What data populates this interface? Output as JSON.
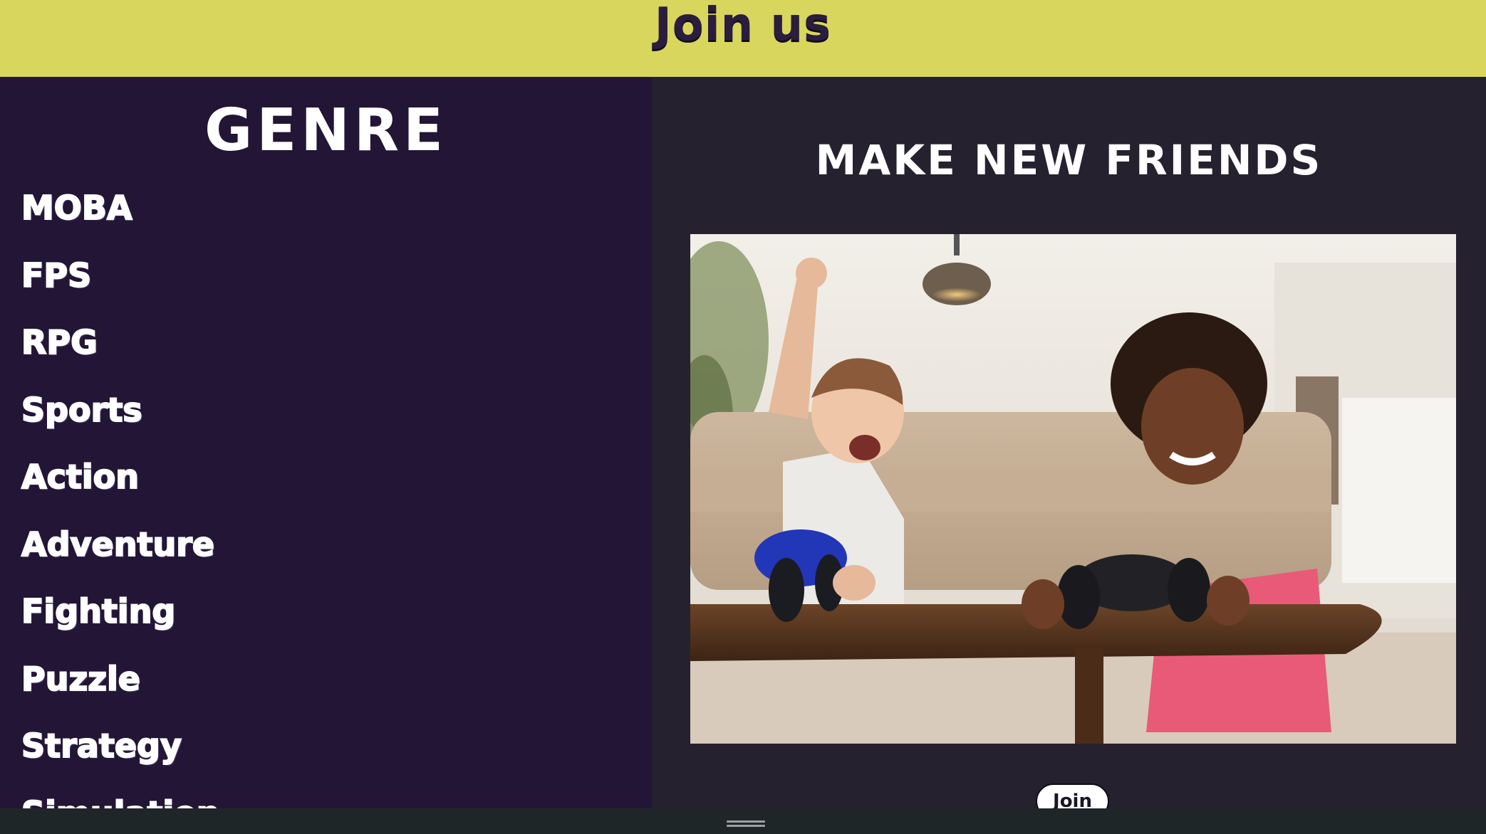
{
  "header": {
    "title": "Join us"
  },
  "sidebar": {
    "title": "GENRE",
    "items": [
      {
        "label": "MOBA"
      },
      {
        "label": "FPS"
      },
      {
        "label": "RPG"
      },
      {
        "label": "Sports"
      },
      {
        "label": "Action"
      },
      {
        "label": "Adventure"
      },
      {
        "label": "Fighting"
      },
      {
        "label": "Puzzle"
      },
      {
        "label": "Strategy"
      },
      {
        "label": "Simulation"
      }
    ]
  },
  "main": {
    "heading": "MAKE NEW FRIENDS",
    "join_label": "Join"
  },
  "colors": {
    "header_bg": "#d9d65e",
    "sidebar_bg": "#231535",
    "main_bg": "#26212f",
    "text": "#ffffff",
    "bottom_bar": "#1f2628"
  },
  "icons": {
    "bottom_handle": "drag-handle-icon"
  }
}
